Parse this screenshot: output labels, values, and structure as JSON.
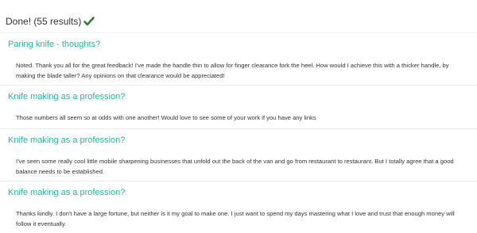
{
  "status": {
    "text": "Done! (55 results)",
    "icon": "checkmark-icon",
    "icon_color": "#2e7d32"
  },
  "colors": {
    "title": "#26b99a",
    "body_text": "#333333",
    "divider": "#ececec"
  },
  "results": [
    {
      "title": "Paring knife - thoughts?",
      "snippet": "Noted. Thank you all for the great feedback! I've made the handle thin to allow for finger clearance fork the heel. How would I achieve this with a thicker handle, by making the blade taller? Any opinions on that clearance would be appreciated!"
    },
    {
      "title": "Knife making as a profession?",
      "snippet": "Those numbers all seem so at odds with one another! Would love to see some of your work if you have any links"
    },
    {
      "title": "Knife making as a profession?",
      "snippet": "I've seen some really cool little mobile sharpening businesses that unfold out the back of the van and go from restaurant to restaurant. But I totally agree that a good balance needs to be established."
    },
    {
      "title": "Knife making as a profession?",
      "snippet": "Thanks kindly. I don't have a large fortune, but neither is it my goal to make one. I just want to spend my days mastering what I love and trust that enough money will follow it eventually."
    }
  ]
}
